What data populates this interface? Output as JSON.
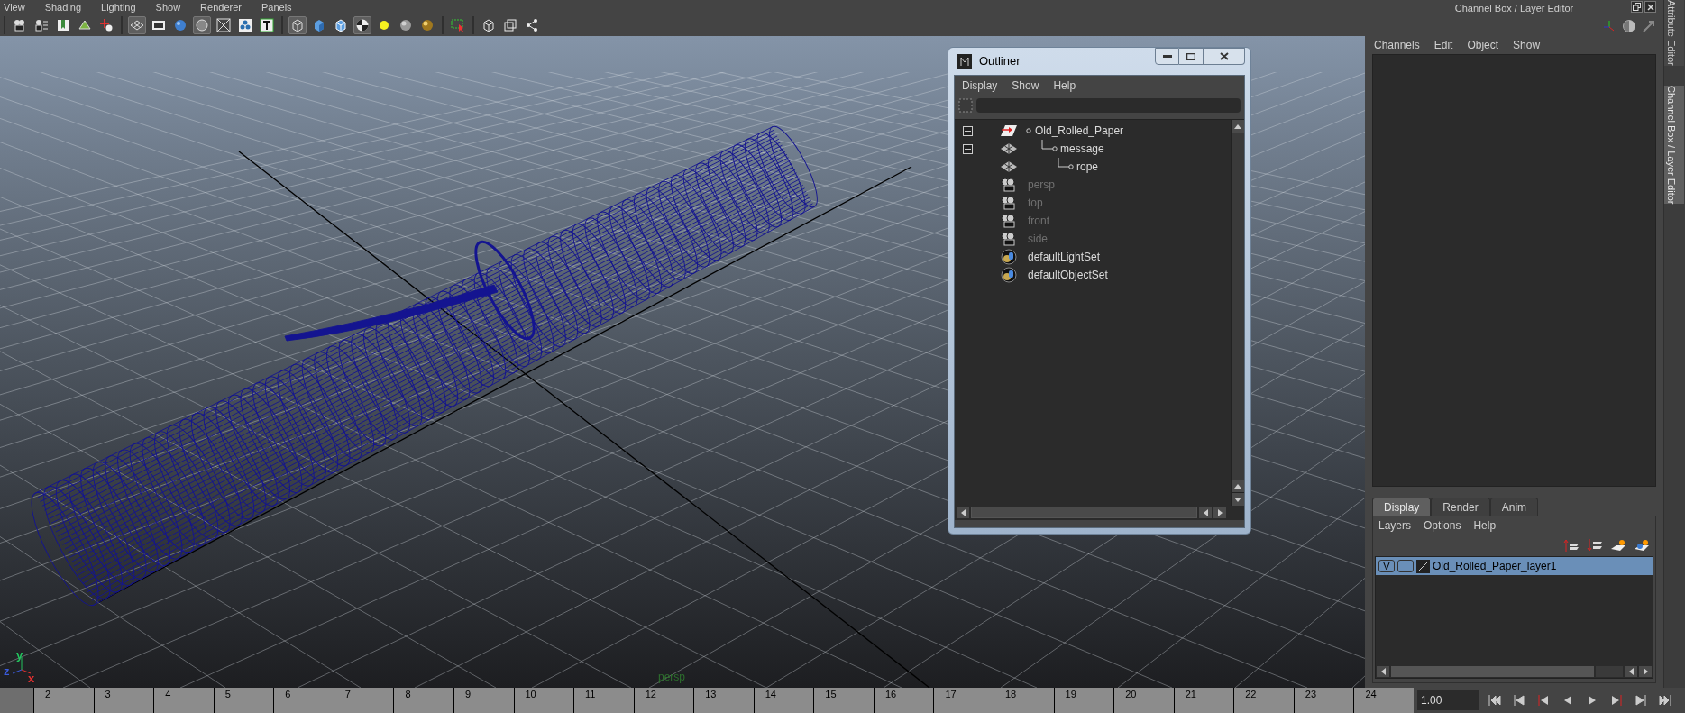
{
  "viewport_menu": [
    "View",
    "Shading",
    "Lighting",
    "Show",
    "Renderer",
    "Panels"
  ],
  "viewport_toolbar": [
    [
      {
        "kind": "camera",
        "selected": false
      },
      {
        "kind": "camera-list",
        "selected": false
      },
      {
        "kind": "bookmark",
        "selected": false
      },
      {
        "kind": "image-plane",
        "selected": false
      },
      {
        "kind": "pan-zoom",
        "selected": false
      }
    ],
    [
      {
        "kind": "grid",
        "selected": true
      },
      {
        "kind": "film-gate",
        "selected": false
      },
      {
        "kind": "shaded-sphere",
        "selected": false
      },
      {
        "kind": "flat-circle",
        "selected": true
      },
      {
        "kind": "xray",
        "selected": false
      },
      {
        "kind": "components",
        "selected": false
      },
      {
        "kind": "text",
        "selected": false
      }
    ],
    [
      {
        "kind": "wire-cube",
        "selected": true
      },
      {
        "kind": "solid-cube",
        "selected": false
      },
      {
        "kind": "wire-solid-cube",
        "selected": false
      },
      {
        "kind": "checker",
        "selected": true
      },
      {
        "kind": "light",
        "selected": false
      },
      {
        "kind": "grey-sphere",
        "selected": false
      },
      {
        "kind": "gold-sphere",
        "selected": false
      }
    ],
    [
      {
        "kind": "select-box",
        "selected": false
      }
    ],
    [
      {
        "kind": "outline-cube",
        "selected": false
      },
      {
        "kind": "overlap-squares",
        "selected": false
      },
      {
        "kind": "share",
        "selected": false
      }
    ]
  ],
  "viewport": {
    "camera_label": "persp",
    "axis_gizmo": [
      {
        "label": "y",
        "color": "#22c55e"
      },
      {
        "label": "z",
        "color": "#3b5bdb"
      },
      {
        "label": "x",
        "color": "#e03131"
      }
    ]
  },
  "outliner": {
    "title": "Outliner",
    "menu": [
      "Display",
      "Show",
      "Help"
    ],
    "tree": [
      {
        "label": "Old_Rolled_Paper",
        "kind": "transform",
        "dimmed": false,
        "expanded": true,
        "children": [
          {
            "label": "message",
            "kind": "mesh",
            "dimmed": false,
            "expanded": true,
            "children": [
              {
                "label": "rope",
                "kind": "mesh",
                "dimmed": false
              }
            ]
          }
        ]
      },
      {
        "label": "persp",
        "kind": "camera",
        "dimmed": true
      },
      {
        "label": "top",
        "kind": "camera",
        "dimmed": true
      },
      {
        "label": "front",
        "kind": "camera",
        "dimmed": true
      },
      {
        "label": "side",
        "kind": "camera",
        "dimmed": true
      },
      {
        "label": "defaultLightSet",
        "kind": "set",
        "dimmed": false
      },
      {
        "label": "defaultObjectSet",
        "kind": "set",
        "dimmed": false
      }
    ]
  },
  "channel_box": {
    "title": "Channel Box / Layer Editor",
    "menu": [
      "Channels",
      "Edit",
      "Object",
      "Show"
    ],
    "layer_editor": {
      "tabs": [
        {
          "label": "Display",
          "selected": true
        },
        {
          "label": "Render",
          "selected": false
        },
        {
          "label": "Anim",
          "selected": false
        }
      ],
      "menu": [
        "Layers",
        "Options",
        "Help"
      ],
      "layers": [
        {
          "visibility": "V",
          "name": "Old_Rolled_Paper_layer1",
          "selected": true
        }
      ]
    }
  },
  "side_tabs": [
    {
      "label": "Attribute Editor",
      "selected": false
    },
    {
      "label": "Channel Box / Layer Editor",
      "selected": true
    }
  ],
  "time_slider": {
    "level": 0,
    "frames": [
      "2",
      "3",
      "4",
      "5",
      "6",
      "7",
      "8",
      "9",
      "10",
      "11",
      "12",
      "13",
      "14",
      "15",
      "16",
      "17",
      "18",
      "19",
      "20",
      "21",
      "22",
      "23",
      "24"
    ]
  },
  "playback": {
    "current_frame": "1.00"
  }
}
